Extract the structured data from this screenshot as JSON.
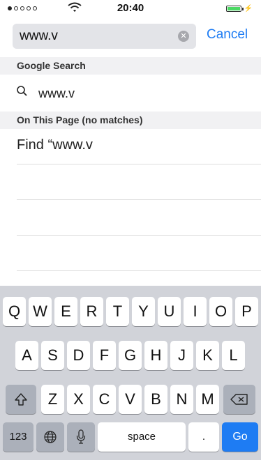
{
  "status_bar": {
    "time": "20:40",
    "signal": [
      true,
      false,
      false,
      false,
      false
    ],
    "battery_level": 1.0
  },
  "search": {
    "query": "www.v",
    "cancel_label": "Cancel",
    "clear_icon": "clear-icon"
  },
  "sections": {
    "google": "Google Search",
    "on_page": "On This Page (no matches)"
  },
  "suggestion": {
    "text": "www.v",
    "icon": "search-icon"
  },
  "find": {
    "text": "Find “www.v"
  },
  "keyboard": {
    "row1": [
      "Q",
      "W",
      "E",
      "R",
      "T",
      "Y",
      "U",
      "I",
      "O",
      "P"
    ],
    "row2": [
      "A",
      "S",
      "D",
      "F",
      "G",
      "H",
      "J",
      "K",
      "L"
    ],
    "row3": [
      "Z",
      "X",
      "C",
      "V",
      "B",
      "N",
      "M"
    ],
    "numbers_label": "123",
    "space_label": "space",
    "dot_label": ".",
    "go_label": "Go",
    "colors": {
      "accent": "#1e7cf3",
      "key": "#ffffff",
      "special_key": "#abb0ba",
      "bg": "#d1d3d9"
    }
  }
}
